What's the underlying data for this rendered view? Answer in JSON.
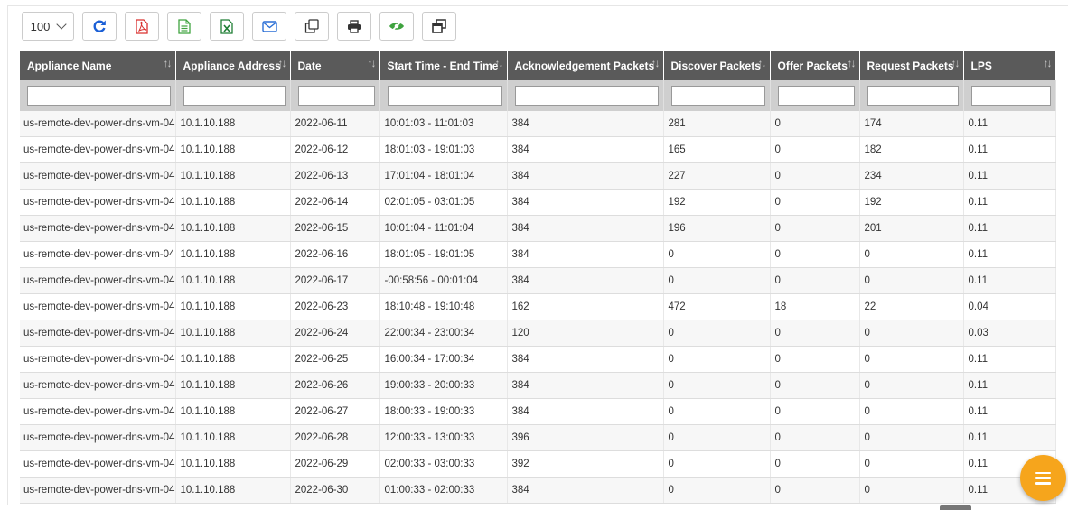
{
  "toolbar": {
    "page_size": "100",
    "buttons": [
      {
        "name": "refresh-icon",
        "color": "#1a5fd6"
      },
      {
        "name": "pdf-icon",
        "color": "#d9302f"
      },
      {
        "name": "csv-icon",
        "color": "#3fa33f"
      },
      {
        "name": "excel-icon",
        "color": "#1e7e34"
      },
      {
        "name": "email-icon",
        "color": "#2a6fd6"
      },
      {
        "name": "copy-icon",
        "color": "#333333"
      },
      {
        "name": "print-icon",
        "color": "#333333"
      },
      {
        "name": "column-visibility-icon",
        "color": "#3fa33f"
      },
      {
        "name": "restore-window-icon",
        "color": "#333333"
      }
    ]
  },
  "table": {
    "columns": [
      "Appliance Name",
      "Appliance Address",
      "Date",
      "Start Time - End Time",
      "Acknowledgement Packets",
      "Discover Packets",
      "Offer Packets",
      "Request Packets",
      "LPS"
    ],
    "rows": [
      [
        "us-remote-dev-power-dns-vm-04",
        "10.1.10.188",
        "2022-06-11",
        "10:01:03 - 11:01:03",
        "384",
        "281",
        "0",
        "174",
        "0.11"
      ],
      [
        "us-remote-dev-power-dns-vm-04",
        "10.1.10.188",
        "2022-06-12",
        "18:01:03 - 19:01:03",
        "384",
        "165",
        "0",
        "182",
        "0.11"
      ],
      [
        "us-remote-dev-power-dns-vm-04",
        "10.1.10.188",
        "2022-06-13",
        "17:01:04 - 18:01:04",
        "384",
        "227",
        "0",
        "234",
        "0.11"
      ],
      [
        "us-remote-dev-power-dns-vm-04",
        "10.1.10.188",
        "2022-06-14",
        "02:01:05 - 03:01:05",
        "384",
        "192",
        "0",
        "192",
        "0.11"
      ],
      [
        "us-remote-dev-power-dns-vm-04",
        "10.1.10.188",
        "2022-06-15",
        "10:01:04 - 11:01:04",
        "384",
        "196",
        "0",
        "201",
        "0.11"
      ],
      [
        "us-remote-dev-power-dns-vm-04",
        "10.1.10.188",
        "2022-06-16",
        "18:01:05 - 19:01:05",
        "384",
        "0",
        "0",
        "0",
        "0.11"
      ],
      [
        "us-remote-dev-power-dns-vm-04",
        "10.1.10.188",
        "2022-06-17",
        "-00:58:56 - 00:01:04",
        "384",
        "0",
        "0",
        "0",
        "0.11"
      ],
      [
        "us-remote-dev-power-dns-vm-04",
        "10.1.10.188",
        "2022-06-23",
        "18:10:48 - 19:10:48",
        "162",
        "472",
        "18",
        "22",
        "0.04"
      ],
      [
        "us-remote-dev-power-dns-vm-04",
        "10.1.10.188",
        "2022-06-24",
        "22:00:34 - 23:00:34",
        "120",
        "0",
        "0",
        "0",
        "0.03"
      ],
      [
        "us-remote-dev-power-dns-vm-04",
        "10.1.10.188",
        "2022-06-25",
        "16:00:34 - 17:00:34",
        "384",
        "0",
        "0",
        "0",
        "0.11"
      ],
      [
        "us-remote-dev-power-dns-vm-04",
        "10.1.10.188",
        "2022-06-26",
        "19:00:33 - 20:00:33",
        "384",
        "0",
        "0",
        "0",
        "0.11"
      ],
      [
        "us-remote-dev-power-dns-vm-04",
        "10.1.10.188",
        "2022-06-27",
        "18:00:33 - 19:00:33",
        "384",
        "0",
        "0",
        "0",
        "0.11"
      ],
      [
        "us-remote-dev-power-dns-vm-04",
        "10.1.10.188",
        "2022-06-28",
        "12:00:33 - 13:00:33",
        "396",
        "0",
        "0",
        "0",
        "0.11"
      ],
      [
        "us-remote-dev-power-dns-vm-04",
        "10.1.10.188",
        "2022-06-29",
        "02:00:33 - 03:00:33",
        "392",
        "0",
        "0",
        "0",
        "0.11"
      ],
      [
        "us-remote-dev-power-dns-vm-04",
        "10.1.10.188",
        "2022-06-30",
        "01:00:33 - 02:00:33",
        "384",
        "0",
        "0",
        "0",
        "0.11"
      ]
    ]
  },
  "fab": {
    "icon": "menu-icon",
    "color": "#f6a51c"
  }
}
